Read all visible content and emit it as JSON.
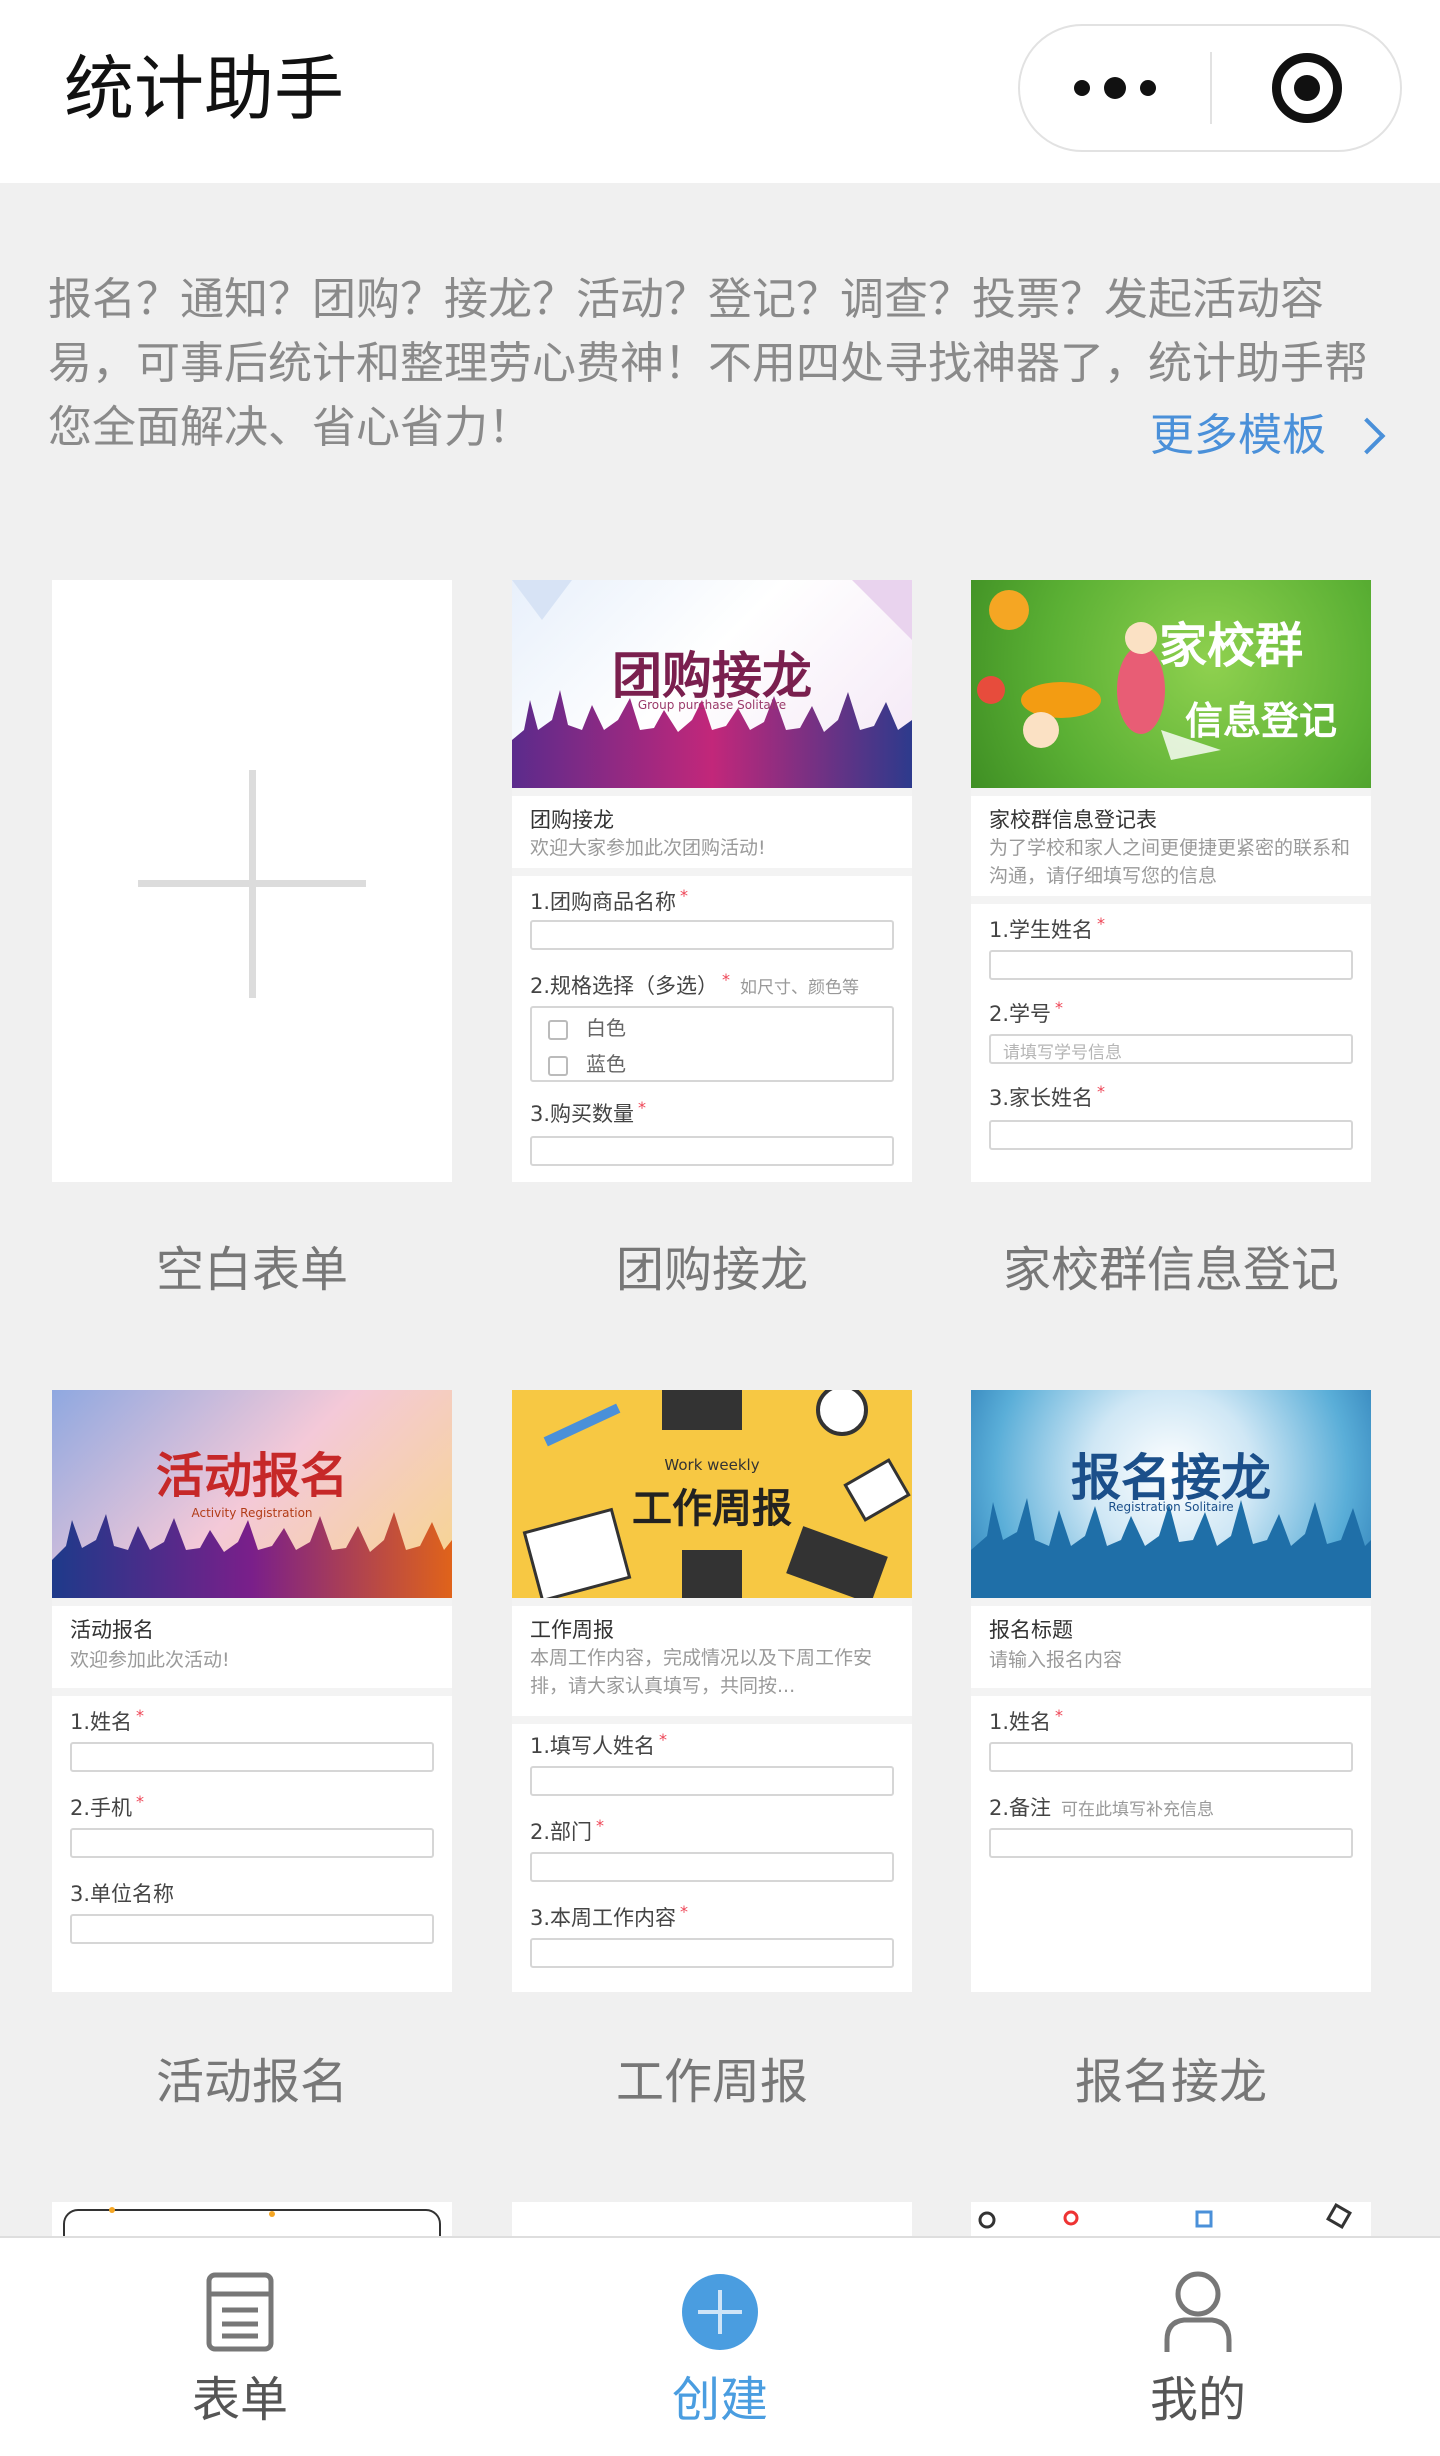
{
  "header": {
    "title": "统计助手"
  },
  "intro": {
    "text": "报名？通知？团购？接龙？活动？登记？调查？投票？发起活动容易，可事后统计和整理劳心费神！不用四处寻找神器了，统计助手帮您全面解决、省心省力！",
    "more_templates": "更多模板"
  },
  "templates": [
    {
      "label": "空白表单"
    },
    {
      "label": "团购接龙",
      "banner_title": "团购接龙",
      "banner_sub": "Group purchase Solitaire",
      "form_title": "团购接龙",
      "form_desc": "欢迎大家参加此次团购活动!",
      "q1": "1.团购商品名称",
      "q2": "2.规格选择（多选）",
      "q2_hint": "如尺寸、颜色等",
      "opt1": "白色",
      "opt2": "蓝色",
      "q3": "3.购买数量"
    },
    {
      "label": "家校群信息登记",
      "banner_title1": "家校群",
      "banner_title2": "信息登记",
      "form_title": "家校群信息登记表",
      "form_desc": "为了学校和家人之间更便捷更紧密的联系和沟通，请仔细填写您的信息",
      "q1": "1.学生姓名",
      "q2": "2.学号",
      "q2_placeholder": "请填写学号信息",
      "q3": "3.家长姓名"
    },
    {
      "label": "活动报名",
      "banner_title": "活动报名",
      "banner_sub": "Activity Registration",
      "form_title": "活动报名",
      "form_desc": "欢迎参加此次活动!",
      "q1": "1.姓名",
      "q2": "2.手机",
      "q3": "3.单位名称"
    },
    {
      "label": "工作周报",
      "banner_sub": "Work weekly",
      "banner_title": "工作周报",
      "form_title": "工作周报",
      "form_desc": "本周工作内容，完成情况以及下周工作安排，请大家认真填写，共同按...",
      "q1": "1.填写人姓名",
      "q2": "2.部门",
      "q3": "3.本周工作内容"
    },
    {
      "label": "报名接龙",
      "banner_title": "报名接龙",
      "banner_sub": "Registration Solitaire",
      "form_title": "报名标题",
      "form_desc": "请输入报名内容",
      "q1": "1.姓名",
      "q2": "2.备注",
      "q2_hint": "可在此填写补充信息"
    }
  ],
  "tabs": [
    {
      "label": "表单"
    },
    {
      "label": "创建"
    },
    {
      "label": "我的"
    }
  ],
  "colors": {
    "accent": "#4a9de0",
    "link": "#4a90d9",
    "background": "#f0f0f0"
  }
}
